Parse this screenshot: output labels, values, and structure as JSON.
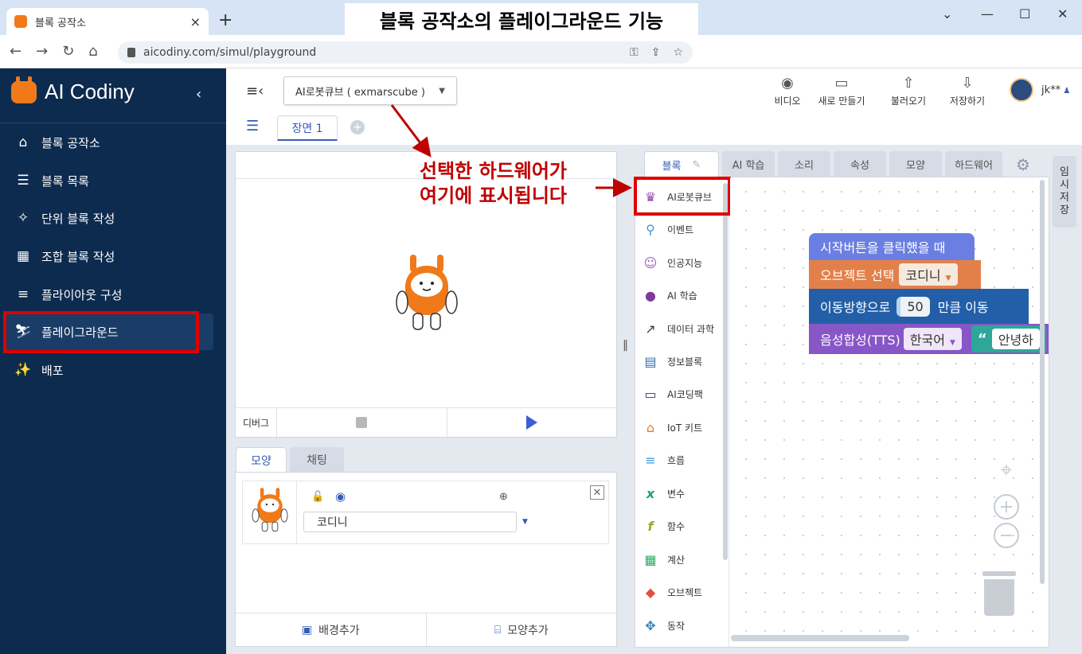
{
  "browser": {
    "tab_title": "블록 공작소",
    "tab_close": "×",
    "new_tab": "+",
    "url": "aicodiny.com/simul/playground",
    "win_min": "—",
    "win_max": "☐",
    "win_close": "✕",
    "win_down": "⌄"
  },
  "headline": "블록 공작소의 플레이그라운드 기능",
  "sidebar": {
    "brand": "AI Codiny",
    "items": [
      {
        "label": "블록 공작소",
        "icon": "home-icon"
      },
      {
        "label": "블록 목록",
        "icon": "list-icon"
      },
      {
        "label": "단위 블록 작성",
        "icon": "puzzle-icon"
      },
      {
        "label": "조합 블록 작성",
        "icon": "grid-icon"
      },
      {
        "label": "플라이아웃 구성",
        "icon": "flyout-icon"
      },
      {
        "label": "플레이그라운드",
        "icon": "ski-icon"
      },
      {
        "label": "배포",
        "icon": "magic-wand-icon"
      }
    ]
  },
  "toolbar": {
    "hardware_select": "AI로봇큐브 ( exmarscube )",
    "buttons": [
      {
        "label": "비디오",
        "icon": "camera-icon"
      },
      {
        "label": "새로 만들기",
        "icon": "new-file-icon"
      },
      {
        "label": "불러오기",
        "icon": "upload-icon"
      },
      {
        "label": "저장하기",
        "icon": "download-icon"
      }
    ],
    "user": "jk**"
  },
  "scene": {
    "tab": "장면 1"
  },
  "stage": {
    "debug_label": "디버그"
  },
  "object_panel": {
    "tabs": [
      "모양",
      "채팅"
    ],
    "object_name": "코디니",
    "add_background": "배경추가",
    "add_shape": "모양추가"
  },
  "block_tabs": [
    "블록",
    "AI 학습",
    "소리",
    "속성",
    "모양",
    "하드웨어"
  ],
  "temp_save": [
    "임",
    "시",
    "저",
    "장"
  ],
  "palette": [
    {
      "label": "AI로봇큐브",
      "icon": "robot-cube-icon",
      "color": "#8e44ad"
    },
    {
      "label": "이벤트",
      "icon": "location-pin-icon",
      "color": "#4a90e2"
    },
    {
      "label": "인공지능",
      "icon": "ai-face-icon",
      "color": "#9b59b6"
    },
    {
      "label": "AI 학습",
      "icon": "ai-learn-icon",
      "color": "#7d3c98"
    },
    {
      "label": "데이터 과학",
      "icon": "chart-icon",
      "color": "#2c3e50"
    },
    {
      "label": "정보블록",
      "icon": "api-icon",
      "color": "#2e6fb0"
    },
    {
      "label": "AI코딩팩",
      "icon": "ai-pack-icon",
      "color": "#1f3f74"
    },
    {
      "label": "IoT 키트",
      "icon": "iot-icon",
      "color": "#e67e22"
    },
    {
      "label": "흐름",
      "icon": "flow-icon",
      "color": "#3498db"
    },
    {
      "label": "변수",
      "icon": "variable-icon",
      "color": "#16a085"
    },
    {
      "label": "함수",
      "icon": "function-icon",
      "color": "#9fa82a"
    },
    {
      "label": "계산",
      "icon": "calculator-icon",
      "color": "#27ae60"
    },
    {
      "label": "오브젝트",
      "icon": "object-icon",
      "color": "#e74c3c"
    },
    {
      "label": "동작",
      "icon": "move-icon",
      "color": "#2980b9"
    }
  ],
  "blocks": {
    "start": "시작버튼을 클릭했을 때",
    "select_label": "오브젝트 선택",
    "select_value": "코디니",
    "move_label": "이동방향으로",
    "move_value": "50",
    "move_suffix": "만큼 이동",
    "tts_label": "음성합성(TTS)",
    "tts_lang": "한국어",
    "tts_text": "안녕하"
  },
  "annotation": {
    "line1": "선택한 하드웨어가",
    "line2": "여기에 표시됩니다"
  },
  "colors": {
    "sidebar_bg": "#0d2b4e",
    "accent": "#355bb3",
    "highlight": "#e00000",
    "brand_orange": "#f07a1a"
  }
}
